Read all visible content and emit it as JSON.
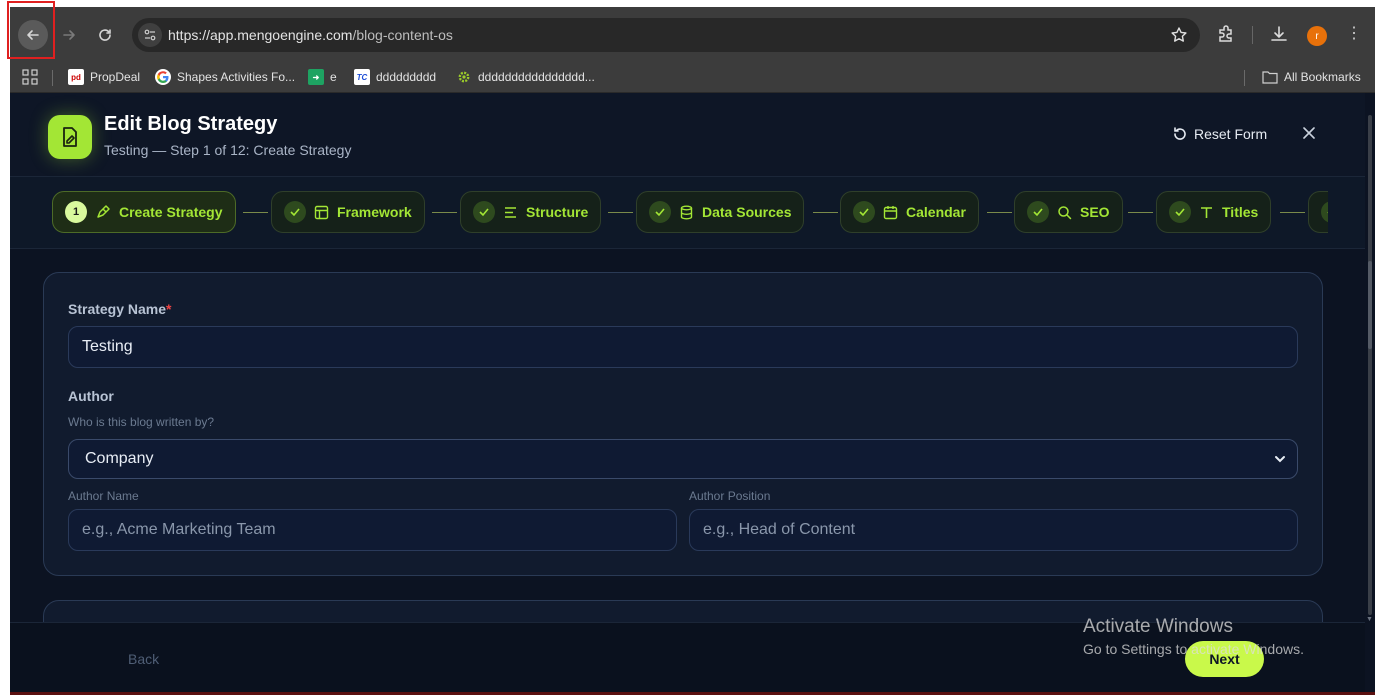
{
  "browser": {
    "url_host": "https://app.mengoengine.com",
    "url_path": "/blog-content-os",
    "avatar_letter": "r",
    "bookmarks": [
      {
        "label": "PropDeal",
        "icon": "propdeal-icon"
      },
      {
        "label": "Shapes Activities Fo...",
        "icon": "google-icon"
      },
      {
        "label": "e",
        "icon": "green-arrow-icon"
      },
      {
        "label": "ddddddddd",
        "icon": "tc-icon"
      },
      {
        "label": "dddddddddddddddd...",
        "icon": "gear-green-icon"
      }
    ],
    "all_bookmarks": "All Bookmarks"
  },
  "header": {
    "title": "Edit Blog Strategy",
    "subtitle": "Testing — Step 1 of 12: Create Strategy",
    "reset_label": "Reset Form"
  },
  "steps": [
    {
      "number": "1",
      "label": "Create Strategy",
      "icon": "strategy-icon",
      "state": "active"
    },
    {
      "label": "Framework",
      "icon": "layout-icon",
      "state": "done"
    },
    {
      "label": "Structure",
      "icon": "lines-icon",
      "state": "done"
    },
    {
      "label": "Data Sources",
      "icon": "database-icon",
      "state": "done"
    },
    {
      "label": "Calendar",
      "icon": "calendar-icon",
      "state": "done"
    },
    {
      "label": "SEO",
      "icon": "search-icon",
      "state": "done"
    },
    {
      "label": "Titles",
      "icon": "text-icon",
      "state": "done"
    }
  ],
  "form": {
    "strategy_name_label": "Strategy Name",
    "required_mark": "*",
    "strategy_name_value": "Testing",
    "author_label": "Author",
    "author_hint": "Who is this blog written by?",
    "author_value": "Company",
    "author_name_label": "Author Name",
    "author_name_placeholder": "e.g., Acme Marketing Team",
    "author_position_label": "Author Position",
    "author_position_placeholder": "e.g., Head of Content"
  },
  "footer": {
    "back_label": "Back",
    "next_label": "Next"
  },
  "watermark": {
    "line1": "Activate Windows",
    "line2": "Go to Settings to activate Windows."
  },
  "colors": {
    "accent": "#a3e635",
    "page_bg": "#0c1322",
    "card_bg": "#111b2e",
    "required": "#ef4444"
  }
}
